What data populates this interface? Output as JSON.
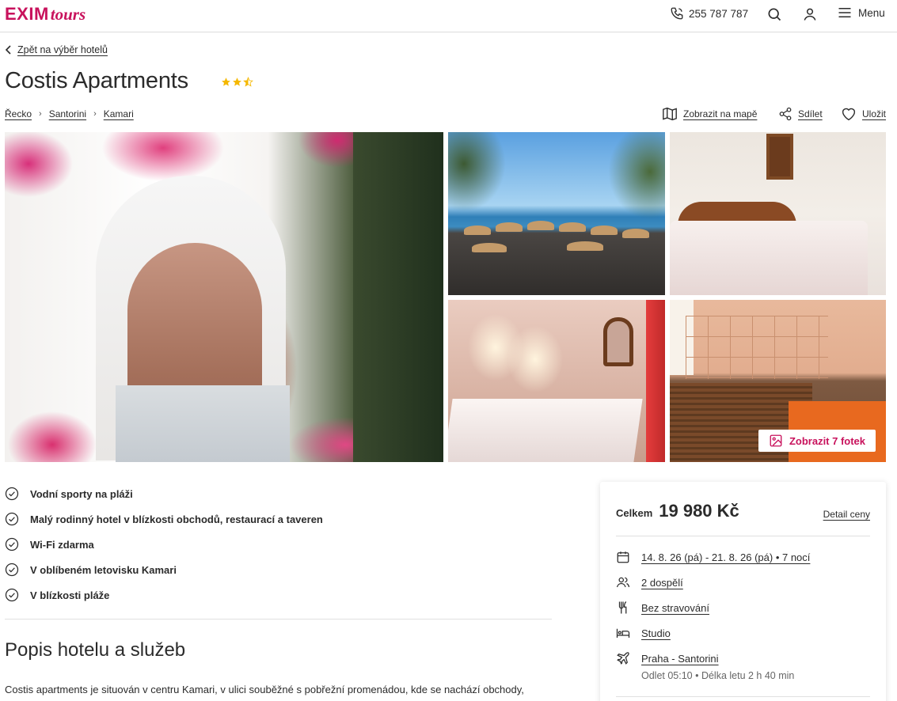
{
  "header": {
    "logo_exim": "EXIM",
    "logo_tours": "tours",
    "phone": "255 787 787",
    "menu_label": "Menu",
    "brand_color": "#c8125c"
  },
  "back_link": "Zpět na výběr hotelů",
  "hotel": {
    "name": "Costis Apartments",
    "rating_stars": 2.5
  },
  "breadcrumb": [
    "Řecko",
    "Santorini",
    "Kamari"
  ],
  "actions": {
    "map": "Zobrazit na mapě",
    "share": "Sdílet",
    "save": "Uložit"
  },
  "gallery": {
    "show_photos": "Zobrazit 7 fotek"
  },
  "features": [
    "Vodní sporty na pláži",
    "Malý rodinný hotel v blízkosti obchodů, restaurací a taveren",
    "Wi-Fi zdarma",
    "V oblíbeném letovisku Kamari",
    "V blízkosti pláže"
  ],
  "description": {
    "title": "Popis hotelu a služeb",
    "text": "Costis apartments je situován v centru Kamari, v ulici souběžné s pobřežní promenádou, kde se nachází obchody,"
  },
  "price_card": {
    "total_label": "Celkem",
    "total_price": "19 980 Kč",
    "detail_link": "Detail ceny",
    "dates": "14. 8. 26 (pá) - 21. 8. 26 (pá) • 7 nocí",
    "guests": "2 dospělí",
    "board": "Bez stravování",
    "room": "Studio",
    "flight": "Praha - Santorini",
    "flight_info": "Odlet 05:10 • Délka letu 2 h 40 min"
  },
  "icons": [
    "phone-icon",
    "search-icon",
    "user-icon",
    "menu-icon",
    "chevron-left-icon",
    "star-icon",
    "map-icon",
    "share-icon",
    "heart-icon",
    "image-icon",
    "check-circle-icon",
    "calendar-icon",
    "people-icon",
    "cutlery-icon",
    "bed-icon",
    "plane-icon"
  ]
}
